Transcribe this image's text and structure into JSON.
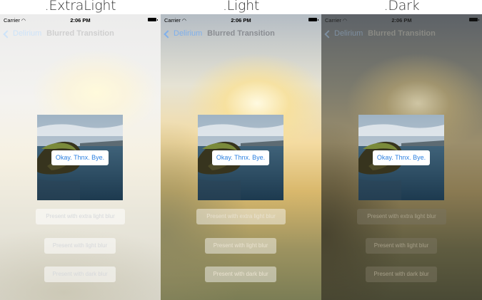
{
  "captions": [
    ".ExtraLight",
    ".Light",
    ".Dark"
  ],
  "screen": {
    "status_bar": {
      "carrier": "Carrier",
      "time": "2:06 PM"
    },
    "nav": {
      "back_label": "Delirium",
      "title": "Blurred Transition"
    },
    "alert_button_label": "Okay. Thnx. Bye.",
    "buttons": {
      "extra_light": "Present with extra light blur",
      "light": "Present with light blur",
      "dark": "Present with dark blur"
    }
  },
  "colors": {
    "accent": "#2a7fe0"
  },
  "icons": [
    "wifi-icon",
    "battery-icon",
    "chevron-left-icon"
  ]
}
